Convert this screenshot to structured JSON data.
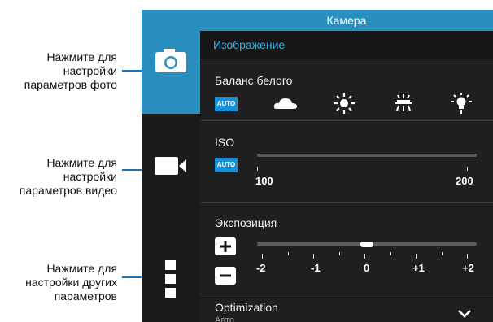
{
  "callouts": {
    "photo": [
      "Нажмите для",
      "настройки",
      "параметров фото"
    ],
    "video": [
      "Нажмите для",
      "настройки",
      "параметров видео"
    ],
    "other": [
      "Нажмите для",
      "настройки других",
      "параметров"
    ]
  },
  "panel": {
    "title": "Камера",
    "section": "Изображение",
    "white_balance": {
      "label": "Баланс белого",
      "auto": "AUTO",
      "icons": [
        "cloud-icon",
        "sun-icon",
        "fluorescent-icon",
        "incandescent-icon"
      ]
    },
    "iso": {
      "label": "ISO",
      "auto": "AUTO",
      "min": "100",
      "max": "200"
    },
    "exposure": {
      "label": "Экспозиция",
      "ticks": [
        "-2",
        "-1",
        "0",
        "+1",
        "+2"
      ],
      "value": 0
    },
    "optimization": {
      "label": "Optimization",
      "value": "Авто"
    }
  },
  "colors": {
    "accent": "#2a8fbf",
    "auto": "#1a8fd6",
    "leader": "#1a73b8"
  }
}
